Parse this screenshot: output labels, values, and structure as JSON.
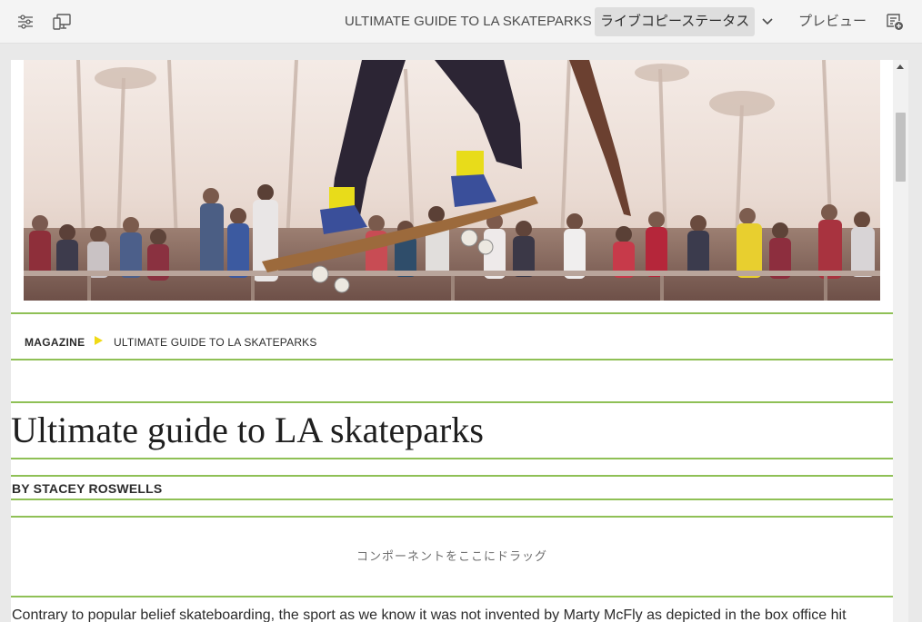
{
  "toolbar": {
    "page_title": "ULTIMATE GUIDE TO LA SKATEPARKS",
    "live_copy_status": "ライブコピーステータス",
    "preview": "プレビュー",
    "icons": [
      "properties-icon",
      "emulator-icon",
      "chevron-down-icon",
      "annotations-icon"
    ]
  },
  "page": {
    "hero_alt": "",
    "breadcrumb": {
      "root": "MAGAZINE",
      "current": "ULTIMATE GUIDE TO LA SKATEPARKS"
    },
    "title": "Ultimate guide to LA skateparks",
    "byline": "BY STACEY ROSWELLS",
    "drop_placeholder": "コンポーネントをここにドラッグ",
    "body_text": "Contrary to popular belief skateboarding, the sport as we know it was not invented by Marty McFly as depicted in the box office hit"
  },
  "colors": {
    "accent_green": "#8fc056",
    "breadcrumb_arrow": "#f0da16"
  }
}
